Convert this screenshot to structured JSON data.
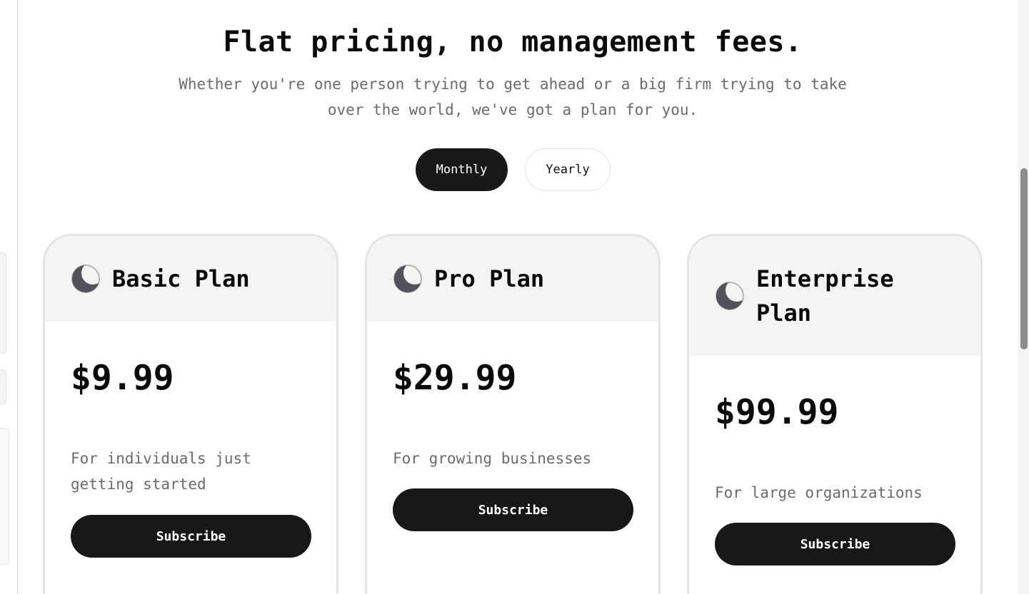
{
  "header": {
    "title": "Flat pricing, no management fees.",
    "subtitle": "Whether you're one person trying to get ahead or a big firm trying to take over the world, we've got a plan for you."
  },
  "billing_toggle": {
    "monthly_label": "Monthly",
    "yearly_label": "Yearly",
    "selected": "Monthly"
  },
  "plans": [
    {
      "icon": "moon-icon",
      "name": "Basic Plan",
      "price": "$9.99",
      "description": "For individuals just getting started",
      "cta": "Subscribe"
    },
    {
      "icon": "moon-icon",
      "name": "Pro Plan",
      "price": "$29.99",
      "description": "For growing businesses",
      "cta": "Subscribe"
    },
    {
      "icon": "moon-icon",
      "name": "Enterprise Plan",
      "price": "$99.99",
      "description": "For large organizations",
      "cta": "Subscribe"
    }
  ],
  "colors": {
    "primary": "#18181b",
    "card_header_bg": "#f4f4f5",
    "muted_text": "#6b6b6b",
    "moon_icon": "#52525b"
  }
}
